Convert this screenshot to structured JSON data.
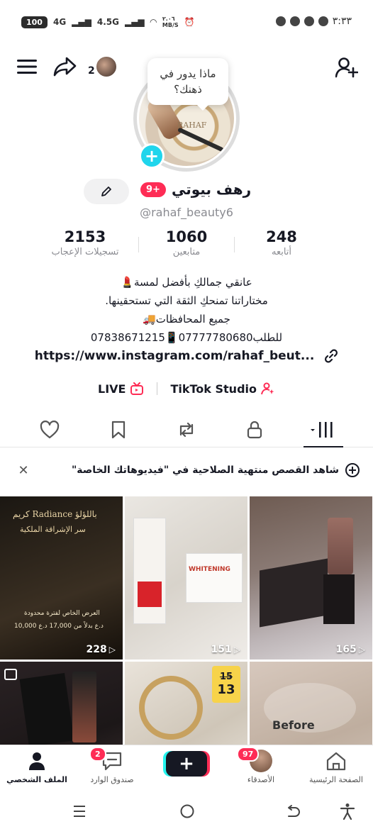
{
  "status_bar": {
    "time": "٣:٣٣",
    "battery": "100",
    "network_1": "4G",
    "network_2": "4.5G",
    "data_speed": "٢.٠٦\nMB/S"
  },
  "header": {
    "followers_preview_count": "2",
    "thought_bubble": "ماذا يدور في ذهنك؟"
  },
  "profile": {
    "display_name": "رهف بيوتي",
    "badge": "9+",
    "username": "@rahaf_beauty6",
    "avatar_label": "RAHAF"
  },
  "stats": [
    {
      "value": "2153",
      "label": "تسجيلات الإعجاب"
    },
    {
      "value": "1060",
      "label": "متابعين"
    },
    {
      "value": "248",
      "label": "أتابعه"
    }
  ],
  "bio": {
    "lines": [
      "عانقي جمالكِ بأفضل لمسة💄",
      "مختاراتنا تمنحكِ الثقة التي تستحقينها.",
      "جميع المحافظات🚚",
      "للطلب07777780680📱07838671215"
    ],
    "link": "https://www.instagram.com/rahaf_beut..."
  },
  "quick_actions": {
    "live": "LIVE",
    "studio": "TikTok Studio"
  },
  "banner": {
    "text": "شاهد القصص منتهية الصلاحية في \"فيديوهاتك الخاصة\""
  },
  "videos": [
    {
      "views": "228",
      "title": "كريم Radiance باللؤلؤ",
      "subtitle": "سر الإشراقة الملكية",
      "promo": "العرض الخاص لفترة محدودة",
      "price": "10,000 د.ع بدلاً من 17,000 د.ع"
    },
    {
      "views": "151",
      "product": "WHITENING"
    },
    {
      "views": "165"
    },
    {
      "views": ""
    },
    {
      "views": "",
      "old_price": "15",
      "new_price": "13"
    },
    {
      "views": "",
      "label": "Before"
    }
  ],
  "bottom_nav": {
    "profile": "الملف الشخصي",
    "inbox": "صندوق الوارد",
    "inbox_badge": "2",
    "friends": "الأصدقاء",
    "friends_badge": "97",
    "home": "الصفحة الرئيسية"
  },
  "colors": {
    "accent": "#fe2c55",
    "cyan": "#20d5ec",
    "text": "#161823",
    "muted": "#8a8b91"
  }
}
